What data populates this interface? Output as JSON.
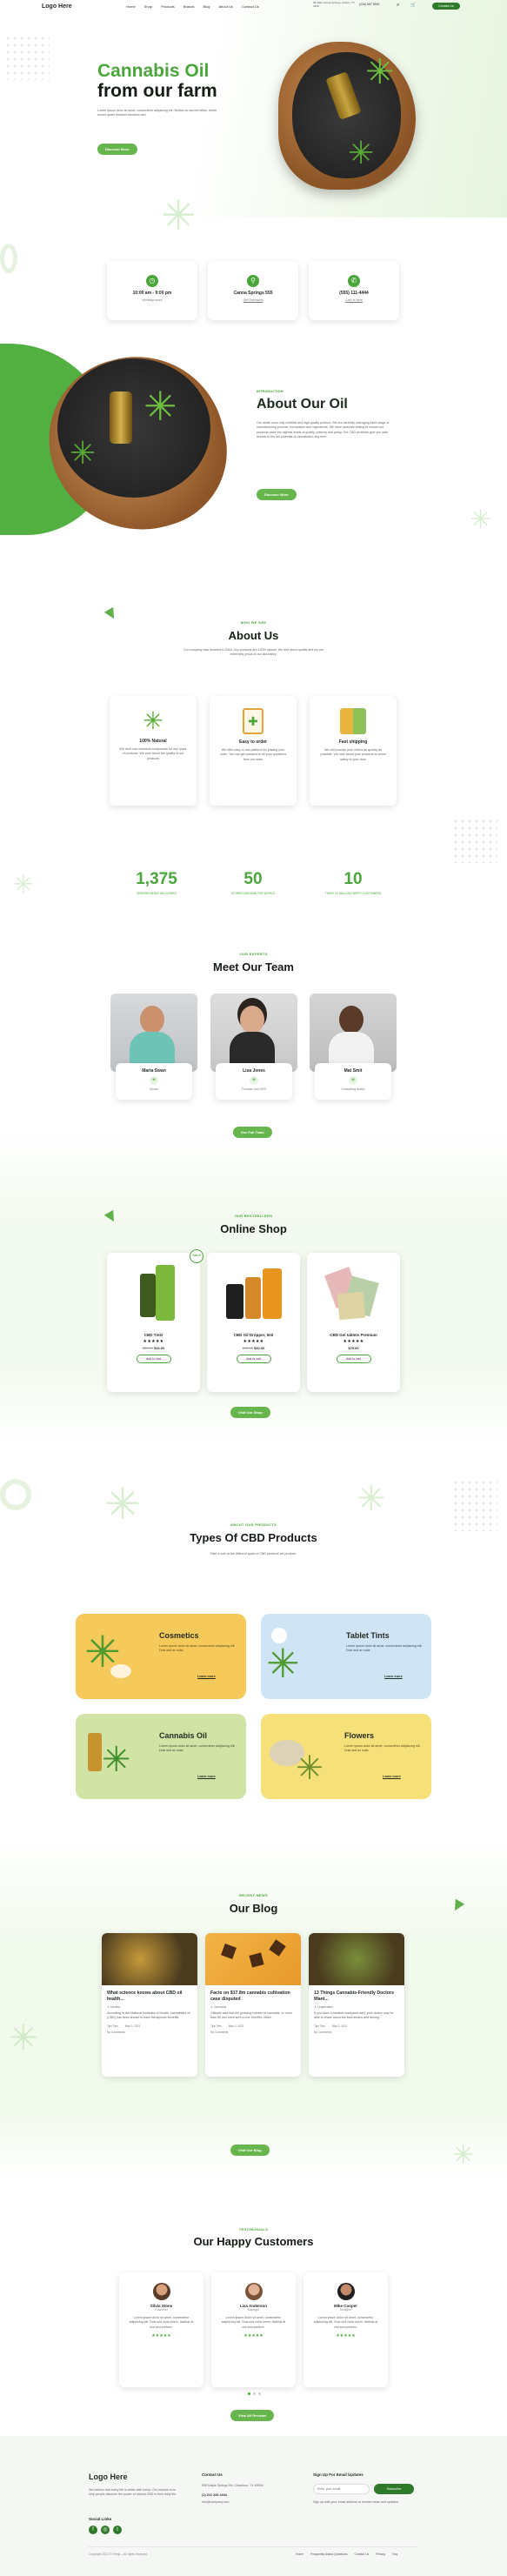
{
  "header": {
    "logo": "Logo Here",
    "nav": [
      "Home",
      "Shop",
      "Products",
      "Brands",
      "Blog",
      "About Us",
      "Contact Us"
    ],
    "address": "5th Main Street Springs, Cactus, TX 4345",
    "phone": "(234) 567 8901",
    "cta": "Contact Us"
  },
  "hero": {
    "title_green": "Cannabis Oil",
    "title_dark": "from our farm",
    "text": "Lorem ipsum dolor sit amet, consectetur adipiscing elit. Nullam ac laoreet tellus. Morbi auctor quam tincidunt faucibus sed.",
    "button": "Discover More"
  },
  "info": [
    {
      "title": "10:00 am - 9:00 pm",
      "sub": "Working hours"
    },
    {
      "title": "Canna Springs 555",
      "sub": "Get Directions"
    },
    {
      "title": "(555) 111-4444",
      "sub": "Call Us Now"
    }
  ],
  "intro": {
    "sub": "INTRODUCTION",
    "title": "About Our Oil",
    "text": "Our lavish uses only certified and high quality product. We are carefully managing each stage of manufacturing process, formulation and ingredients. We have accurate testing to ensure our products have the highest levels of quality, potency and purity. Our CBD products give you safe access to the full potential of cannabidiol, any time.",
    "button": "Discover More"
  },
  "about": {
    "sub": "WHO WE ARE",
    "title": "About Us",
    "text": "Our company was founded in 2018. Our products are 100% natural. We test about quality and we are extremely proud of our laboratory.",
    "features": [
      {
        "title": "100% Natural",
        "text": "We don't use chemical compounds for any types of products. We care about the quality of our products"
      },
      {
        "title": "Easy to order",
        "text": "We offer easy to use platform for placing your order. You can get answers to all your questions from our team"
      },
      {
        "title": "Fast shipping",
        "text": "We will process your orders as quickly as possible. We care about your products to arrive safely to your door"
      }
    ]
  },
  "stats": [
    {
      "num": "1,375",
      "label": "ORDERS BEING DELIVERED"
    },
    {
      "num": "50",
      "label": "STORES AROUND THE WORLD"
    },
    {
      "num": "10",
      "label": "TIMES 10 MILLION HAPPY CUSTOMERS"
    }
  ],
  "team": {
    "sub": "OUR EXPERTS",
    "title": "Meet Our Team",
    "members": [
      {
        "name": "Maria Swan",
        "role": "Doctor"
      },
      {
        "name": "Lisa Jones",
        "role": "Founder and CEO"
      },
      {
        "name": "Mat Smit",
        "role": "Consulting doctor"
      }
    ],
    "button": "See Full Team"
  },
  "shop": {
    "sub": "OUR BESTSELLERS",
    "title": "Online Shop",
    "products": [
      {
        "name": "CBD Tintz",
        "old": "$20.00",
        "price": "$16.00",
        "badge": "SALE",
        "btn": "Add to cart"
      },
      {
        "name": "CBD Oil Dropper, 5ml",
        "old": "$42.00",
        "price": "$40.00",
        "btn": "Add to cart"
      },
      {
        "name": "CBD Gel tablets Premium",
        "price": "$79.00",
        "btn": "Add to cart"
      }
    ],
    "button": "Visit Our Shop"
  },
  "types": {
    "sub": "ABOUT OUR PRODUCTS",
    "title": "Types Of CBD Products",
    "text": "Take a look at the different types of CBD products we produce.",
    "items": [
      {
        "title": "Cosmetics",
        "text": "Lorem ipsum dolor sit amet, consectetur adipiscing elit. Duis sed ac nulla.",
        "link": "Learn more"
      },
      {
        "title": "Tablet Tints",
        "text": "Lorem ipsum dolor sit amet, consectetur adipiscing elit. Duis sed ac nulla.",
        "link": "Learn more"
      },
      {
        "title": "Cannabis Oil",
        "text": "Lorem ipsum dolor sit amet, consectetur adipiscing elit. Duis sed ac nulla.",
        "link": "Learn more"
      },
      {
        "title": "Flowers",
        "text": "Lorem ipsum dolor sit amet, consectetur adipiscing elit. Duis sed ac nulla.",
        "link": "Learn more"
      }
    ]
  },
  "blog": {
    "sub": "RECENT NEWS",
    "title": "Our Blog",
    "posts": [
      {
        "title": "What science knows about CBD oil health...",
        "author": "Monika",
        "text": "According to the National Institutes of Health, cannabidiol oil (CBD) has been shown to have therapeutic benefits.",
        "cat": "Tips Tars",
        "date": "May 3, 2021",
        "comments": "No Comments"
      },
      {
        "title": "Facts on $17.8m cannabis cultivation case disputed",
        "author": "Cannabis",
        "text": "Officials said that the growing number of cannabis, or more than 80 mm were sent to the Sheriff's Office.",
        "cat": "Tips Tars",
        "date": "May 3, 2021",
        "comments": "No Comments"
      },
      {
        "title": "13 Things Cannabis-Friendly Doctors Want...",
        "author": "Legalization",
        "text": "If you have a medical marijuana card, your doctor may be able to share about the best strains and dosing.",
        "cat": "Tips Tars",
        "date": "May 3, 2021",
        "comments": "No Comments"
      }
    ],
    "button": "Visit Our Blog"
  },
  "customers": {
    "sub": "TESTIMONIALS",
    "title": "Our Happy Customers",
    "items": [
      {
        "name": "Silvia Stone",
        "role": "Customer",
        "text": "Lorem ipsum dolor sit amet, consectetur adipiscing elit. Duis sed nulla lorem, facilisis at nisl sed pretium."
      },
      {
        "name": "Lisa Anderson",
        "role": "Manager",
        "text": "Lorem ipsum dolor sit amet, consectetur adipiscing elit. Duis sed nulla lorem, facilisis at nisl sed pretium."
      },
      {
        "name": "Mike Cooper",
        "role": "Designer",
        "text": "Lorem ipsum dolor sit amet, consectetur adipiscing elit. Duis sed nulla lorem, facilisis at nisl sed pretium."
      }
    ],
    "button": "View All Reviews"
  },
  "footer": {
    "logo": "Logo Here",
    "text": "We believe that every life is better with hemp. Our mission is to help people discover the power of natural CBD in their daily life.",
    "social": "Social Links",
    "contact_title": "Contact Us",
    "address": "555 Maple Springs Rd, Chamboo, TX 48546",
    "phone": "(1) 222 333 4444",
    "email": "info@company.com",
    "sign_title": "Sign Up For Email Updates",
    "sign_placeholder": "Enter your email",
    "sign_btn": "Subscribe",
    "sign_text": "Sign up with your email address to receive news and updates.",
    "copyright": "Copyright 2021 © Hemp – All rights reserved",
    "links": [
      "Home",
      "Frequently Asked Questions",
      "Contact Us",
      "Privacy",
      "Faq"
    ]
  },
  "colors": {
    "green": "#4aa63a",
    "light_green": "#eef7ea"
  }
}
